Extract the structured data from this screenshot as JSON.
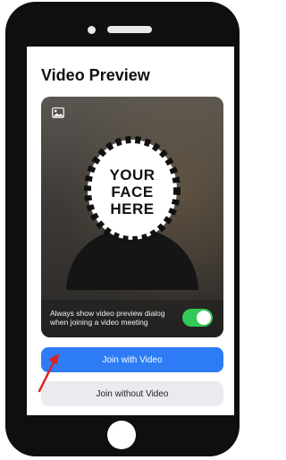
{
  "screen": {
    "title": "Video Preview"
  },
  "preview": {
    "placeholder_lines": [
      "YOUR",
      "FACE",
      "HERE"
    ],
    "always_show_label": "Always show video preview dialog when joining a video meeting",
    "always_show_enabled": true
  },
  "buttons": {
    "join_with_video": "Join with Video",
    "join_without_video": "Join without Video"
  },
  "colors": {
    "primary": "#2d7cf6",
    "toggle_on": "#34c759",
    "annotation_arrow": "#e0201f"
  },
  "icons": {
    "preview_corner": "image-icon",
    "annotation": "red-arrow"
  }
}
